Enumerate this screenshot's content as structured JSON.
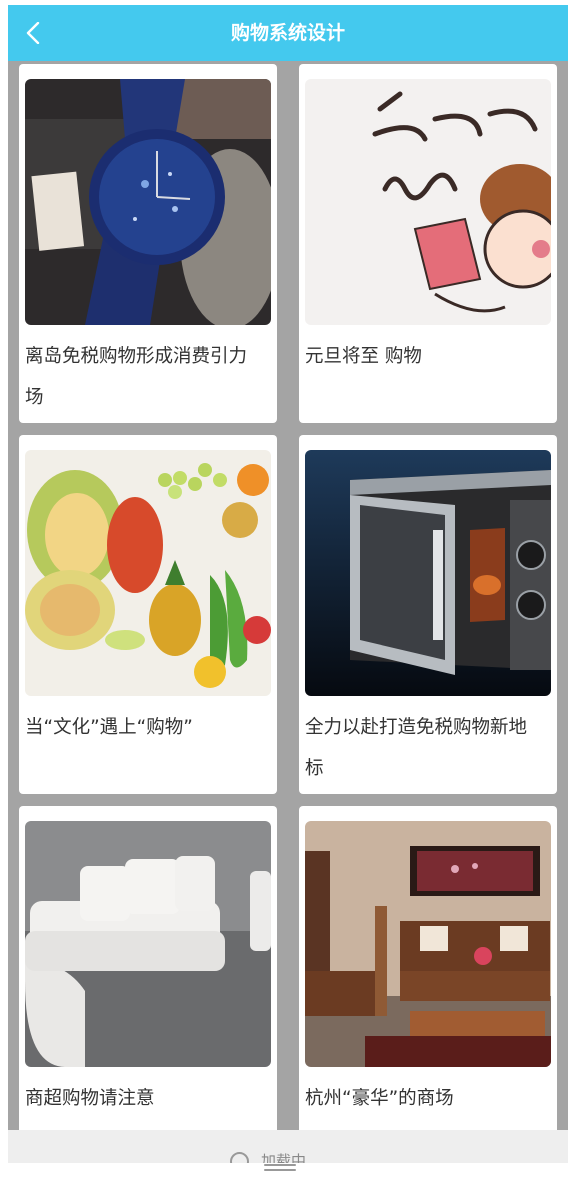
{
  "header": {
    "title": "购物系统设计",
    "back_icon": "chevron-left-icon"
  },
  "items": [
    {
      "caption": "离岛免税购物形成消费引力场",
      "image": "wristwatch-photo"
    },
    {
      "caption": "元旦将至 购物",
      "image": "cartoon-buy-buy-buy-illustration"
    },
    {
      "caption": "当“文化”遇上“购物”",
      "image": "fruit-platter-photo"
    },
    {
      "caption": "全力以赴打造免税购物新地标",
      "image": "microwave-oven-photo"
    },
    {
      "caption": "商超购物请注意",
      "image": "white-sofa-photo"
    },
    {
      "caption": "杭州“豪华”的商场",
      "image": "wooden-living-room-furniture-photo"
    }
  ],
  "footer": {
    "loading_text": "加载中"
  },
  "colors": {
    "header": "#44c9ee",
    "background": "#a4a4a4",
    "card": "#ffffff",
    "text": "#333333"
  }
}
